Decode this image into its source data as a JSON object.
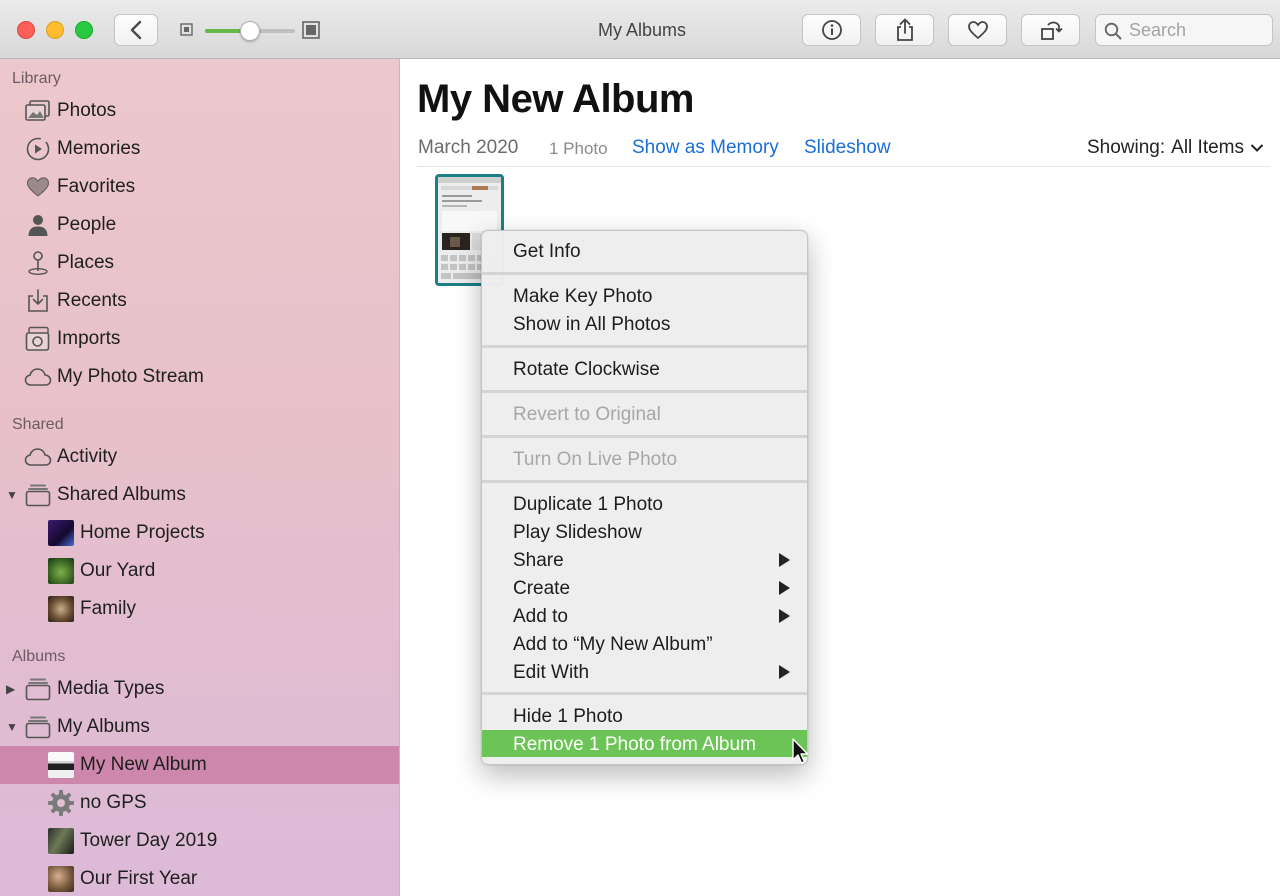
{
  "window": {
    "title": "My Albums"
  },
  "toolbar": {
    "back_icon": "chevron-left-icon",
    "zoom_level": 0.5,
    "search_placeholder": "Search",
    "search_value": ""
  },
  "sidebar": {
    "library_header": "Library",
    "library_items": [
      {
        "label": "Photos",
        "icon": "photos-icon"
      },
      {
        "label": "Memories",
        "icon": "memories-icon"
      },
      {
        "label": "Favorites",
        "icon": "heart-icon"
      },
      {
        "label": "People",
        "icon": "person-icon"
      },
      {
        "label": "Places",
        "icon": "pin-icon"
      },
      {
        "label": "Recents",
        "icon": "recents-icon"
      },
      {
        "label": "Imports",
        "icon": "camera-icon"
      },
      {
        "label": "My Photo Stream",
        "icon": "cloud-icon"
      }
    ],
    "shared_header": "Shared",
    "shared_items": [
      {
        "label": "Activity",
        "icon": "cloud-icon"
      },
      {
        "label": "Shared Albums",
        "icon": "album-stack-icon"
      },
      {
        "label": "Home Projects",
        "icon": "album-thumbnail"
      },
      {
        "label": "Our Yard",
        "icon": "album-thumbnail"
      },
      {
        "label": "Family",
        "icon": "album-thumbnail"
      }
    ],
    "albums_header": "Albums",
    "album_items": [
      {
        "label": "Media Types",
        "icon": "album-stack-icon"
      },
      {
        "label": "My Albums",
        "icon": "album-stack-icon"
      },
      {
        "label": "My New Album",
        "icon": "album-thumbnail",
        "selected": true
      },
      {
        "label": "no GPS",
        "icon": "gear-icon"
      },
      {
        "label": "Tower Day 2019",
        "icon": "album-thumbnail"
      },
      {
        "label": "Our First Year",
        "icon": "album-thumbnail"
      }
    ]
  },
  "main": {
    "album_title": "My New Album",
    "date": "March 2020",
    "count": "1 Photo",
    "show_as_memory": "Show as Memory",
    "slideshow": "Slideshow",
    "showing_label": "Showing:",
    "showing_value": "All Items"
  },
  "context_menu": {
    "items": [
      {
        "label": "Get Info"
      },
      {
        "label": "Make Key Photo"
      },
      {
        "label": "Show in All Photos"
      },
      {
        "label": "Rotate Clockwise"
      },
      {
        "label": "Revert to Original",
        "disabled": true
      },
      {
        "label": "Turn On Live Photo",
        "disabled": true
      },
      {
        "label": "Duplicate 1 Photo"
      },
      {
        "label": "Play Slideshow"
      },
      {
        "label": "Share",
        "submenu": true
      },
      {
        "label": "Create",
        "submenu": true
      },
      {
        "label": "Add to",
        "submenu": true
      },
      {
        "label": "Add to “My New Album”"
      },
      {
        "label": "Edit With",
        "submenu": true
      },
      {
        "label": "Hide 1 Photo"
      },
      {
        "label": "Remove 1 Photo from Album",
        "highlighted": true
      }
    ]
  },
  "colors": {
    "accent_link": "#1a6ed8",
    "selection": "#cd86ac",
    "menu_highlight": "#6cc456",
    "zoom_fill": "#63b84a"
  }
}
